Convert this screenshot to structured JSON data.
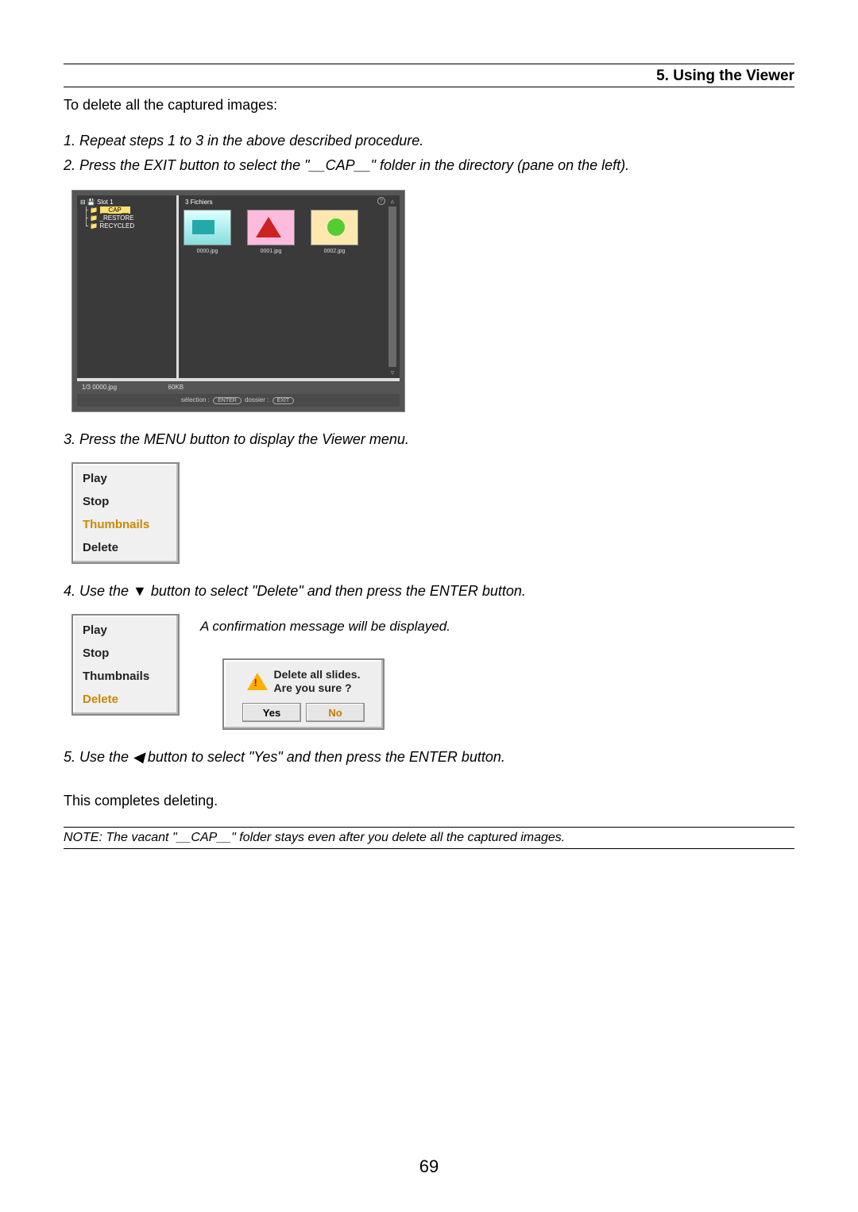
{
  "header": {
    "section": "5. Using the Viewer"
  },
  "intro": "To delete all the captured images:",
  "steps": {
    "s1": "1.  Repeat steps 1 to 3 in the above described procedure.",
    "s2": "2.  Press the EXIT button to select the \"__CAP__\" folder in the directory (pane on the left).",
    "s3": "3.  Press the MENU button to display the Viewer menu.",
    "s4": "4.  Use the ▼ button to select \"Delete\" and then press the ENTER button.",
    "s5": "5.  Use the ◀ button to select \"Yes\" and then press the ENTER button."
  },
  "viewer": {
    "tree": {
      "root": "⊟ 💾 Slot 1",
      "cap": "__CAP__",
      "restore": "_RESTORE",
      "recycled": "RECYCLED"
    },
    "thumb_header": "3 Fichiers",
    "files": [
      "0000.jpg",
      "0001.jpg",
      "0002.jpg"
    ],
    "status_left": "1/3  0000.jpg",
    "status_size": "60KB",
    "hint_select": "sélection :",
    "hint_enter": "ENTER",
    "hint_folder": "dossier :",
    "hint_exit": "EXIT"
  },
  "menu1": {
    "play": "Play",
    "stop": "Stop",
    "thumbnails": "Thumbnails",
    "delete": "Delete"
  },
  "confirm_note": "A confirmation message will be displayed.",
  "menu2": {
    "play": "Play",
    "stop": "Stop",
    "thumbnails": "Thumbnails",
    "delete": "Delete"
  },
  "dialog": {
    "line1": "Delete all slides.",
    "line2": "Are you sure ?",
    "yes": "Yes",
    "no": "No"
  },
  "final": "This completes deleting.",
  "note": "NOTE: The vacant \"__CAP__\" folder stays even after you delete all the captured images.",
  "page_number": "69"
}
